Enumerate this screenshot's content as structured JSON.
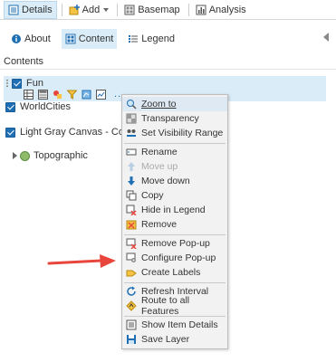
{
  "toolbar": {
    "details": "Details",
    "add": "Add",
    "basemap": "Basemap",
    "analysis": "Analysis"
  },
  "subtabs": {
    "about": "About",
    "content": "Content",
    "legend": "Legend"
  },
  "contents_title": "Contents",
  "layers": {
    "fun": "Fun",
    "worldcities": "WorldCities",
    "lightgray": "Light Gray Canvas - Copy",
    "topographic": "Topographic"
  },
  "layer_more": "...",
  "menu": {
    "zoom_to": "Zoom to",
    "transparency": "Transparency",
    "set_visibility_range": "Set Visibility Range",
    "rename": "Rename",
    "move_up": "Move up",
    "move_down": "Move down",
    "copy": "Copy",
    "hide_in_legend": "Hide in Legend",
    "remove": "Remove",
    "remove_popup": "Remove Pop-up",
    "configure_popup": "Configure Pop-up",
    "create_labels": "Create Labels",
    "refresh_interval": "Refresh Interval",
    "route_to_all_features": "Route to all Features",
    "show_item_details": "Show Item Details",
    "save_layer": "Save Layer"
  },
  "colors": {
    "accent": "#1f6fb5",
    "selected_bg": "#d9ecf7",
    "arrow": "#e8463c"
  }
}
